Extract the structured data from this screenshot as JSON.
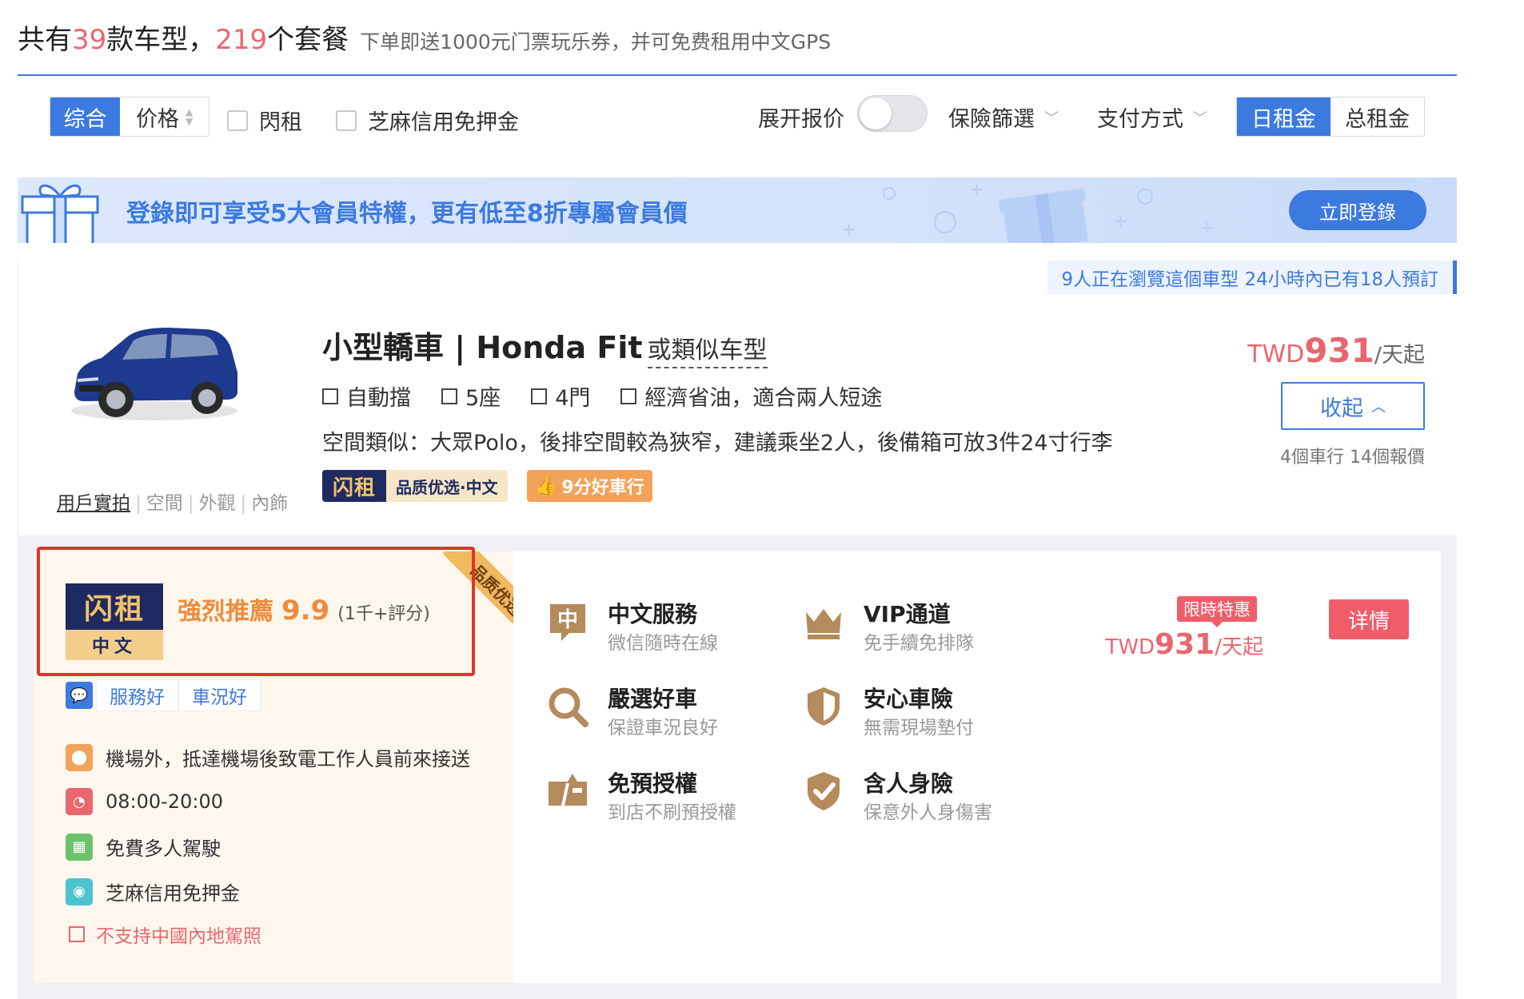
{
  "summary": {
    "prefix": "共有",
    "model_count": "39",
    "mid": "款车型，",
    "package_count": "219",
    "suffix": "个套餐",
    "note": "下单即送1000元门票玩乐券，并可免费租用中文GPS"
  },
  "filters": {
    "sort_combined": "综合",
    "sort_price": "价格",
    "flash_rent": "閃租",
    "sesame_deposit": "芝麻信用免押金",
    "expand_quotes": "展开报价",
    "insurance_filter": "保險篩選",
    "payment_method": "支付方式",
    "daily_rate": "日租金",
    "total_rate": "总租金"
  },
  "banner": {
    "message": "登錄即可享受5大會員特權，更有低至8折專屬會員價",
    "login_button": "立即登錄"
  },
  "car": {
    "watchers": "9人正在瀏覽這個車型  24小時內已有18人預訂",
    "title": "小型轎車 | Honda Fit",
    "similar": "或類似车型",
    "features": [
      "自動擋",
      "5座",
      "4門",
      "經濟省油，適合兩人短途"
    ],
    "space_desc": "空間類似：大眾Polo，後排空間較為狹窄，建議乘坐2人，後備箱可放3件24寸行李",
    "tag_logo": "闪租",
    "tag_text": "品质优选·中文",
    "tag_good": "9分好車行",
    "photo_links": {
      "user_photos": "用戶實拍",
      "space": "空間",
      "exterior": "外觀",
      "interior": "內飾"
    },
    "price": {
      "currency": "TWD",
      "amount": "931",
      "unit": "/天起"
    },
    "collapse_label": "收起",
    "quote_count": "4個車行 14個報價"
  },
  "package": {
    "ribbon": "品质优选",
    "logo_top": "闪租",
    "logo_bottom": "中文",
    "rating_label": "強烈推薦",
    "rating_score": "9.9",
    "rating_count": "(1千+評分)",
    "service_tags": [
      "服務好",
      "車況好"
    ],
    "info": [
      {
        "icon": "location-icon",
        "text": "機場外，抵達機場後致電工作人員前來接送"
      },
      {
        "icon": "clock-icon",
        "text": "08:00-20:00"
      },
      {
        "icon": "gift-icon",
        "text": "免費多人駕駛"
      },
      {
        "icon": "deposit-icon",
        "text": "芝麻信用免押金"
      }
    ],
    "warning": "不支持中國內地駕照",
    "benefits": [
      {
        "icon": "chinese-service-icon",
        "title": "中文服務",
        "sub": "微信隨時在線"
      },
      {
        "icon": "vip-crown-icon",
        "title": "VIP通道",
        "sub": "免手續免排隊"
      },
      {
        "icon": "search-car-icon",
        "title": "嚴選好車",
        "sub": "保證車況良好"
      },
      {
        "icon": "shield-icon",
        "title": "安心車險",
        "sub": "無需現場墊付"
      },
      {
        "icon": "card-icon",
        "title": "免預授權",
        "sub": "到店不刷預授權"
      },
      {
        "icon": "shield-check-icon",
        "title": "含人身險",
        "sub": "保意外人身傷害"
      }
    ],
    "promo_tag": "限時特惠",
    "price": {
      "currency": "TWD",
      "amount": "931",
      "unit": "/天起"
    },
    "detail_button": "详情"
  },
  "colors": {
    "accent": "#3c7ae0",
    "price": "#e8676f",
    "brand_dark": "#1f2a60",
    "brand_gold": "#f1c26a",
    "highlight_frame": "#e0342a"
  }
}
